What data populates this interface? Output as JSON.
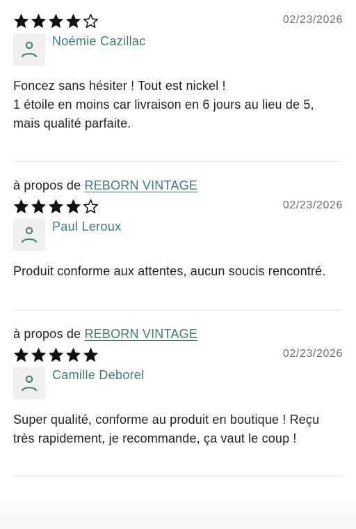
{
  "reviews": [
    {
      "about_prefix": "",
      "about_link": "",
      "rating": 4,
      "max_rating": 5,
      "date": "02/23/2026",
      "author": "Noémie Cazillac",
      "text": "Foncez sans hésiter ! Tout est nickel !\n1 étoile en moins car livraison en 6 jours au lieu de 5, mais qualité parfaite."
    },
    {
      "about_prefix": "à propos de",
      "about_link": "REBORN VINTAGE",
      "rating": 4,
      "max_rating": 5,
      "date": "02/23/2026",
      "author": "Paul Leroux",
      "text": "Produit conforme aux attentes, aucun soucis rencontré."
    },
    {
      "about_prefix": "à propos de",
      "about_link": "REBORN VINTAGE",
      "rating": 5,
      "max_rating": 5,
      "date": "02/23/2026",
      "author": "Camille Deborel",
      "text": "Super qualité, conforme au produit en boutique ! Reçu très rapidement, je recommande, ça vaut le coup !"
    }
  ],
  "icons": {
    "filled_star": "star-filled-icon",
    "empty_star": "star-outline-icon",
    "avatar": "user-icon"
  },
  "colors": {
    "accent": "#3a7d6e",
    "date": "#6f6f6f",
    "text": "#1f1f1f",
    "avatar_bg": "#efefef"
  }
}
